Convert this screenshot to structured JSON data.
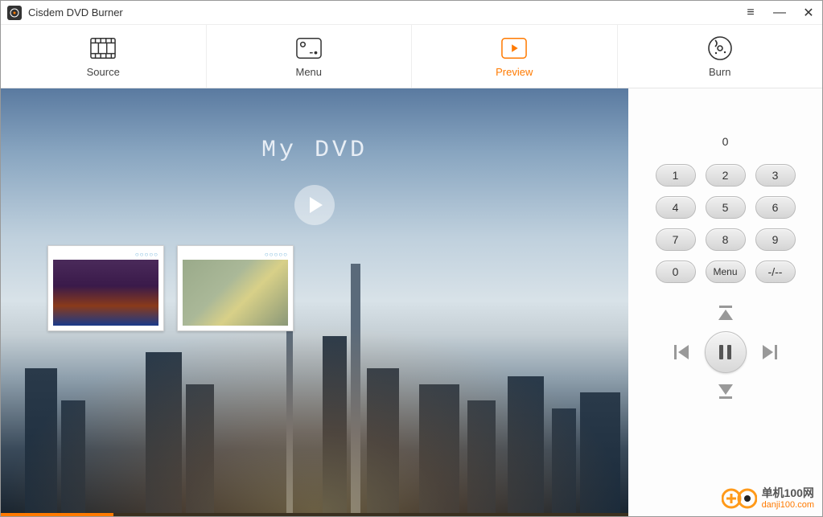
{
  "app": {
    "title": "Cisdem DVD Burner"
  },
  "tabs": [
    {
      "label": "Source"
    },
    {
      "label": "Menu"
    },
    {
      "label": "Preview"
    },
    {
      "label": "Burn"
    }
  ],
  "preview": {
    "title": "My DVD",
    "thumb_dots": "○○○○○"
  },
  "remote": {
    "counter": "0",
    "keys": [
      "1",
      "2",
      "3",
      "4",
      "5",
      "6",
      "7",
      "8",
      "9",
      "0",
      "Menu",
      "-/--"
    ]
  },
  "watermark": {
    "cn": "单机100网",
    "url": "danji100.com"
  }
}
